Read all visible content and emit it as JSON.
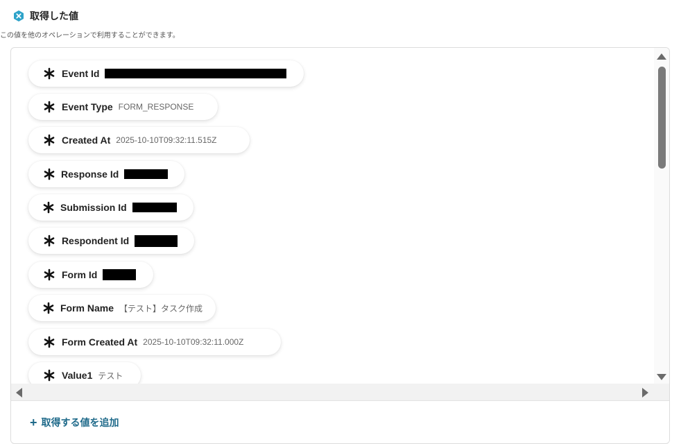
{
  "header": {
    "title": "取得した値",
    "subtitle": "この値を他のオペレーションで利用することができます。",
    "icon": "hexagon-x-icon",
    "accent_color": "#2ea3c9"
  },
  "items": [
    {
      "label": "Event Id",
      "value": "",
      "redacted": true
    },
    {
      "label": "Event Type",
      "value": "FORM_RESPONSE",
      "redacted": false
    },
    {
      "label": "Created At",
      "value": "2025-10-10T09:32:11.515Z",
      "redacted": false
    },
    {
      "label": "Response Id",
      "value": "",
      "redacted": true
    },
    {
      "label": "Submission Id",
      "value": "",
      "redacted": true
    },
    {
      "label": "Respondent Id",
      "value": "",
      "redacted": true
    },
    {
      "label": "Form Id",
      "value": "",
      "redacted": true
    },
    {
      "label": "Form Name",
      "value": "【テスト】タスク作成",
      "redacted": false
    },
    {
      "label": "Form Created At",
      "value": "2025-10-10T09:32:11.000Z",
      "redacted": false
    },
    {
      "label": "Value1",
      "value": "テスト",
      "redacted": false
    }
  ],
  "footer": {
    "add_label": "取得する値を追加",
    "add_icon": "plus-icon",
    "link_color": "#1f6a8a"
  }
}
